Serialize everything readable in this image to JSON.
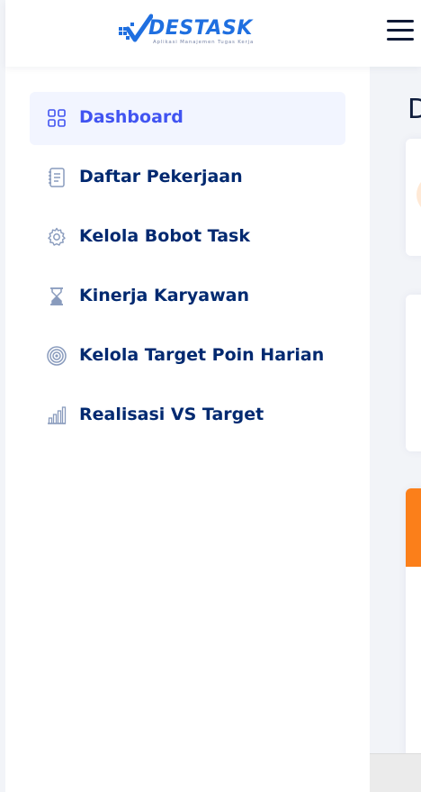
{
  "header": {
    "logo_text": "DESTASK",
    "logo_subtitle": "Aplikasi Manajemen Tugas Kerja",
    "menu_icon": "hamburger-icon"
  },
  "sidebar": {
    "items": [
      {
        "label": "Dashboard",
        "icon": "grid-icon",
        "active": true
      },
      {
        "label": "Daftar Pekerjaan",
        "icon": "journal-icon",
        "active": false
      },
      {
        "label": "Kelola Bobot Task",
        "icon": "gear-icon",
        "active": false
      },
      {
        "label": "Kinerja Karyawan",
        "icon": "hourglass-icon",
        "active": false
      },
      {
        "label": "Kelola Target Poin Harian",
        "icon": "target-icon",
        "active": false
      },
      {
        "label": "Realisasi VS Target",
        "icon": "bar-chart-icon",
        "active": false
      }
    ]
  },
  "main": {
    "page_title": "D"
  },
  "colors": {
    "active": "#4154f1",
    "text": "#012970",
    "accent_orange": "#fb7f1a",
    "logo_blue": "#1f6fe0"
  }
}
